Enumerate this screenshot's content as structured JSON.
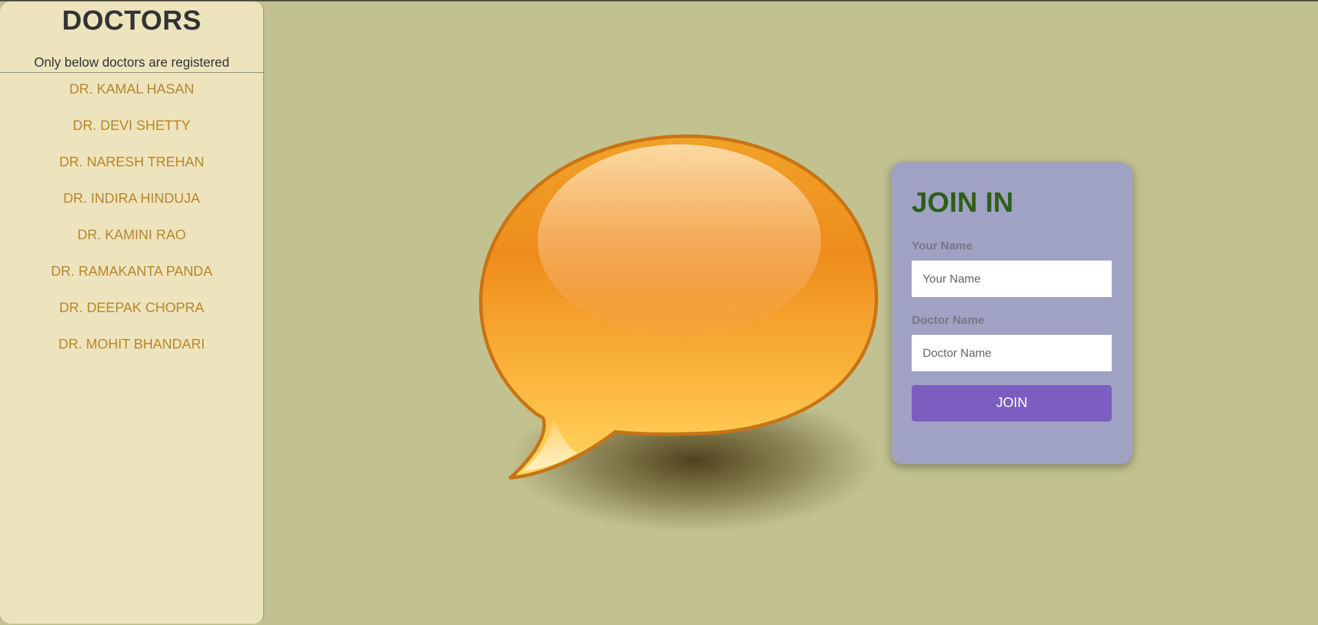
{
  "sidebar": {
    "title": "DOCTORS",
    "subtitle": "Only below doctors are registered",
    "doctors": [
      "DR. KAMAL HASAN",
      "DR. DEVI SHETTY",
      "DR. NARESH TREHAN",
      "DR. INDIRA HINDUJA",
      "DR. KAMINI RAO",
      "DR. RAMAKANTA PANDA",
      "DR. DEEPAK CHOPRA",
      "DR. MOHIT BHANDARI"
    ]
  },
  "hero": {
    "icon": "chat-bubble-icon"
  },
  "join_form": {
    "title": "JOIN IN",
    "name_label": "Your Name",
    "name_placeholder": "Your Name",
    "name_value": "",
    "doctor_label": "Doctor Name",
    "doctor_placeholder": "Doctor Name",
    "doctor_value": "",
    "button_label": "JOIN"
  },
  "colors": {
    "page_background": "#c2c290",
    "sidebar_background": "#ede4be",
    "doctor_link": "#b8862a",
    "card_background": "#a0a2c4",
    "card_title": "#2e5e18",
    "button_background": "#7b5ec0",
    "bubble": "#f5a623"
  }
}
